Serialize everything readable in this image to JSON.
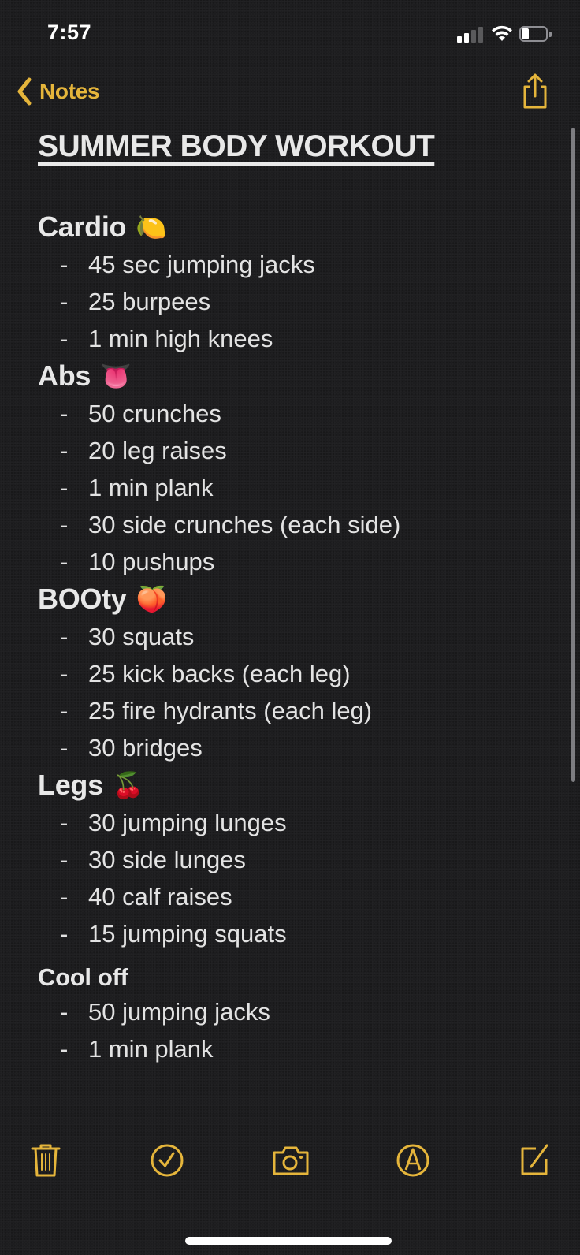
{
  "status_bar": {
    "time": "7:57",
    "signal_bars_active": 2,
    "signal_bars_total": 4,
    "wifi_icon": "wifi-icon",
    "battery_level": 0.3
  },
  "nav": {
    "back_label": "Notes",
    "back_icon": "chevron-left-icon",
    "share_icon": "share-icon"
  },
  "colors": {
    "accent": "#e5b53b",
    "background": "#1d1d1f",
    "text": "#e6e6e6"
  },
  "note": {
    "title": "SUMMER BODY WORKOUT",
    "sections": [
      {
        "heading": "Cardio",
        "emoji": "🍋",
        "emoji_name": "lemon-emoji",
        "items": [
          "45 sec jumping jacks",
          "25 burpees",
          "1 min high knees"
        ]
      },
      {
        "heading": "Abs",
        "emoji": "👅",
        "emoji_name": "tongue-emoji",
        "items": [
          "50 crunches",
          "20 leg raises",
          "1 min plank",
          "30 side crunches (each side)",
          "10 pushups"
        ]
      },
      {
        "heading": "BOOty",
        "emoji": "🍑",
        "emoji_name": "peach-emoji",
        "items": [
          "30 squats",
          "25 kick backs (each leg)",
          "25 fire hydrants (each leg)",
          "30 bridges"
        ]
      },
      {
        "heading": "Legs",
        "emoji": "🍒",
        "emoji_name": "cherries-emoji",
        "items": [
          "30 jumping lunges",
          "30 side lunges",
          "40 calf raises",
          "15 jumping squats"
        ]
      },
      {
        "heading": "Cool off",
        "emoji": "",
        "emoji_name": "",
        "items": [
          "50 jumping jacks",
          "1 min plank"
        ]
      }
    ],
    "bullet": "-"
  },
  "toolbar": {
    "items": [
      {
        "name": "delete-button",
        "icon": "trash-icon"
      },
      {
        "name": "checklist-button",
        "icon": "checkmark-circle-icon"
      },
      {
        "name": "camera-button",
        "icon": "camera-icon"
      },
      {
        "name": "markup-button",
        "icon": "pen-tip-circle-icon"
      },
      {
        "name": "compose-button",
        "icon": "compose-icon"
      }
    ]
  }
}
